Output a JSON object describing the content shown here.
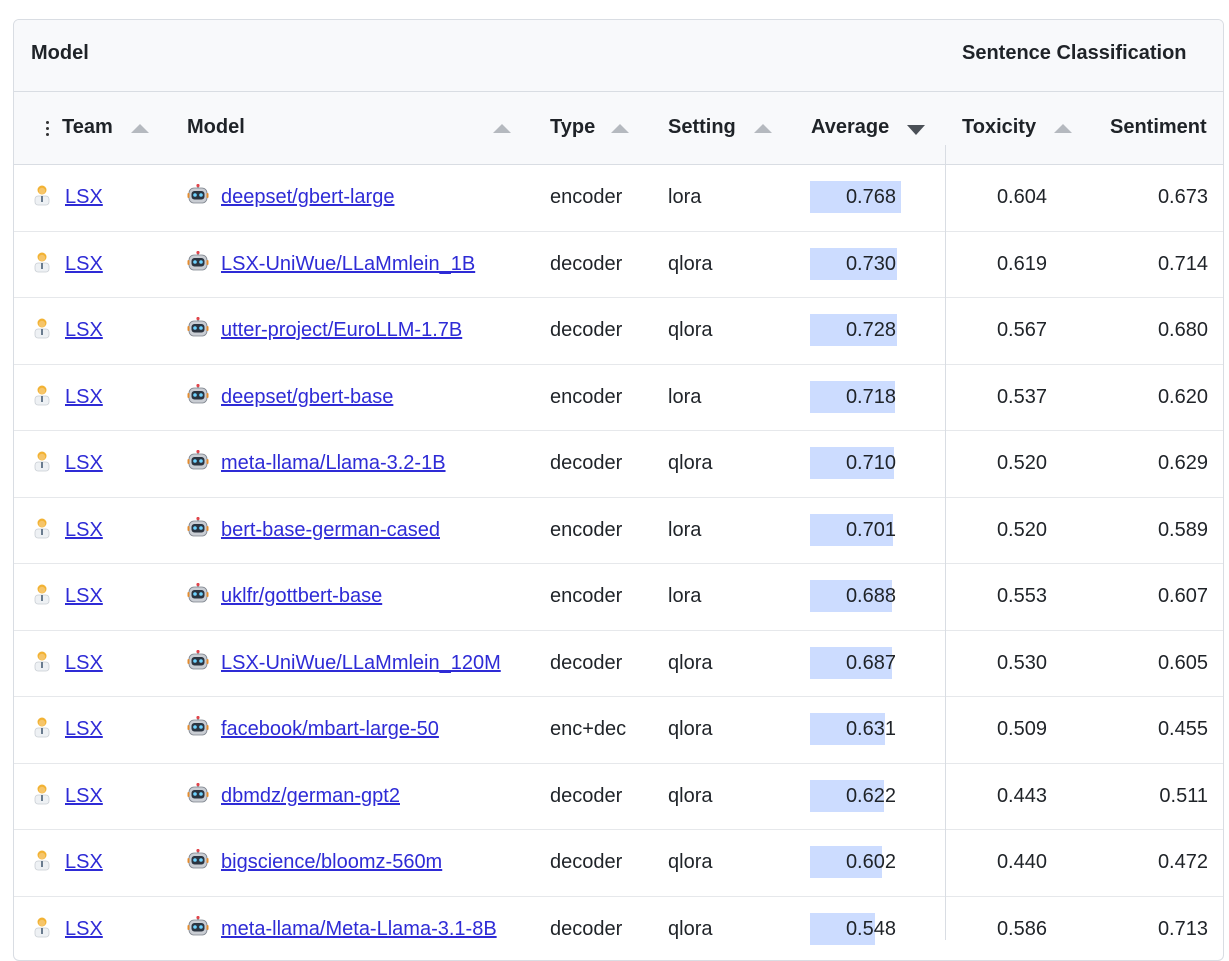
{
  "group_header": {
    "model": "Model",
    "sentence_classification": "Sentence Classification"
  },
  "columns": {
    "team": "Team",
    "model": "Model",
    "type": "Type",
    "setting": "Setting",
    "average": "Average",
    "toxicity": "Toxicity",
    "sentiment": "Sentiment"
  },
  "sort": {
    "column": "Average",
    "direction": "descending"
  },
  "colors": {
    "bar": "#ccdcff",
    "link": "#2e2bd6"
  },
  "rows": [
    {
      "team": "LSX",
      "model": "deepset/gbert-large",
      "type": "encoder",
      "setting": "lora",
      "average": "0.768",
      "toxicity": "0.604",
      "sentiment": "0.673"
    },
    {
      "team": "LSX",
      "model": "LSX-UniWue/LLaMmlein_1B",
      "type": "decoder",
      "setting": "qlora",
      "average": "0.730",
      "toxicity": "0.619",
      "sentiment": "0.714"
    },
    {
      "team": "LSX",
      "model": "utter-project/EuroLLM-1.7B",
      "type": "decoder",
      "setting": "qlora",
      "average": "0.728",
      "toxicity": "0.567",
      "sentiment": "0.680"
    },
    {
      "team": "LSX",
      "model": "deepset/gbert-base",
      "type": "encoder",
      "setting": "lora",
      "average": "0.718",
      "toxicity": "0.537",
      "sentiment": "0.620"
    },
    {
      "team": "LSX",
      "model": "meta-llama/Llama-3.2-1B",
      "type": "decoder",
      "setting": "qlora",
      "average": "0.710",
      "toxicity": "0.520",
      "sentiment": "0.629"
    },
    {
      "team": "LSX",
      "model": "bert-base-german-cased",
      "type": "encoder",
      "setting": "lora",
      "average": "0.701",
      "toxicity": "0.520",
      "sentiment": "0.589"
    },
    {
      "team": "LSX",
      "model": "uklfr/gottbert-base",
      "type": "encoder",
      "setting": "lora",
      "average": "0.688",
      "toxicity": "0.553",
      "sentiment": "0.607"
    },
    {
      "team": "LSX",
      "model": "LSX-UniWue/LLaMmlein_120M",
      "type": "decoder",
      "setting": "qlora",
      "average": "0.687",
      "toxicity": "0.530",
      "sentiment": "0.605"
    },
    {
      "team": "LSX",
      "model": "facebook/mbart-large-50",
      "type": "enc+dec",
      "setting": "qlora",
      "average": "0.631",
      "toxicity": "0.509",
      "sentiment": "0.455"
    },
    {
      "team": "LSX",
      "model": "dbmdz/german-gpt2",
      "type": "decoder",
      "setting": "qlora",
      "average": "0.622",
      "toxicity": "0.443",
      "sentiment": "0.511"
    },
    {
      "team": "LSX",
      "model": "bigscience/bloomz-560m",
      "type": "decoder",
      "setting": "qlora",
      "average": "0.602",
      "toxicity": "0.440",
      "sentiment": "0.472"
    },
    {
      "team": "LSX",
      "model": "meta-llama/Meta-Llama-3.1-8B",
      "type": "decoder",
      "setting": "qlora",
      "average": "0.548",
      "toxicity": "0.586",
      "sentiment": "0.713"
    }
  ]
}
